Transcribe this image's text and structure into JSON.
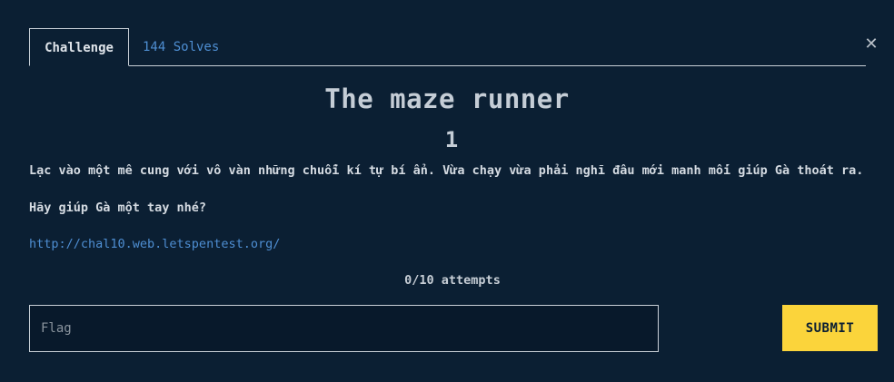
{
  "close": {
    "symbol": "✕",
    "icon": "close-icon"
  },
  "tabs": {
    "challenge_label": "Challenge",
    "solves_label": "144 Solves"
  },
  "challenge": {
    "name": "The maze runner",
    "value": "1",
    "description": [
      "Lạc vào một mê cung với vô vàn những chuỗi kí tự bí ẩn. Vừa chạy vừa phải nghĩ đâu mới manh mối giúp Gà thoát ra.",
      "Hãy giúp Gà một tay nhé?"
    ],
    "link": "http://chal10.web.letspentest.org/",
    "attempts": "0/10 attempts"
  },
  "form": {
    "flag_placeholder": "Flag",
    "flag_value": "",
    "submit_label": "SUBMIT"
  },
  "colors": {
    "background": "#0b1f33",
    "accent": "#fbd43b",
    "link": "#4e8ed2"
  }
}
